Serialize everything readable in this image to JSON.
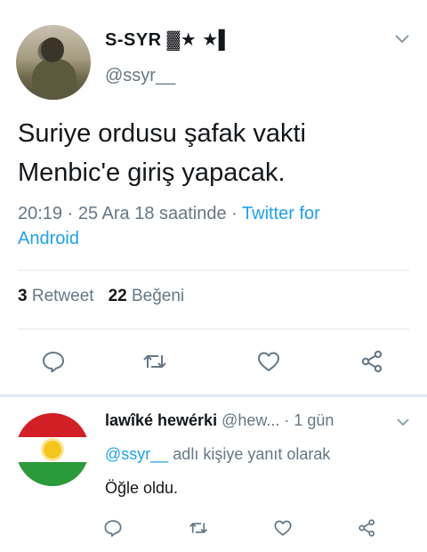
{
  "tweet": {
    "display_name": "S-SYR ▓★ ★▌",
    "handle": "@ssyr__",
    "text_line1": "Suriye ordusu şafak vakti",
    "text_line2": "Menbic'e giriş yapacak.",
    "time_date": "20:19 · 25 Ara 18 saatinde · ",
    "source_line1": "Twitter for",
    "source_line2": "Android",
    "retweet_count": "3",
    "retweet_label": "Retweet",
    "like_count": "22",
    "like_label": "Beğeni"
  },
  "reply": {
    "display_name": "lawîké hewérki",
    "handle": "@hew...",
    "time": " · 1 gün",
    "reply_to_handle": "@ssyr__",
    "reply_to_suffix": " adlı kişiye yanıt olarak",
    "text": "Öğle oldu."
  },
  "icons": [
    "reply-icon",
    "retweet-icon",
    "like-icon",
    "share-icon",
    "chevron-down-icon"
  ],
  "colors": {
    "link": "#1da1f2",
    "muted": "#657786",
    "text": "#14171a",
    "divider": "#e1e8ed"
  }
}
